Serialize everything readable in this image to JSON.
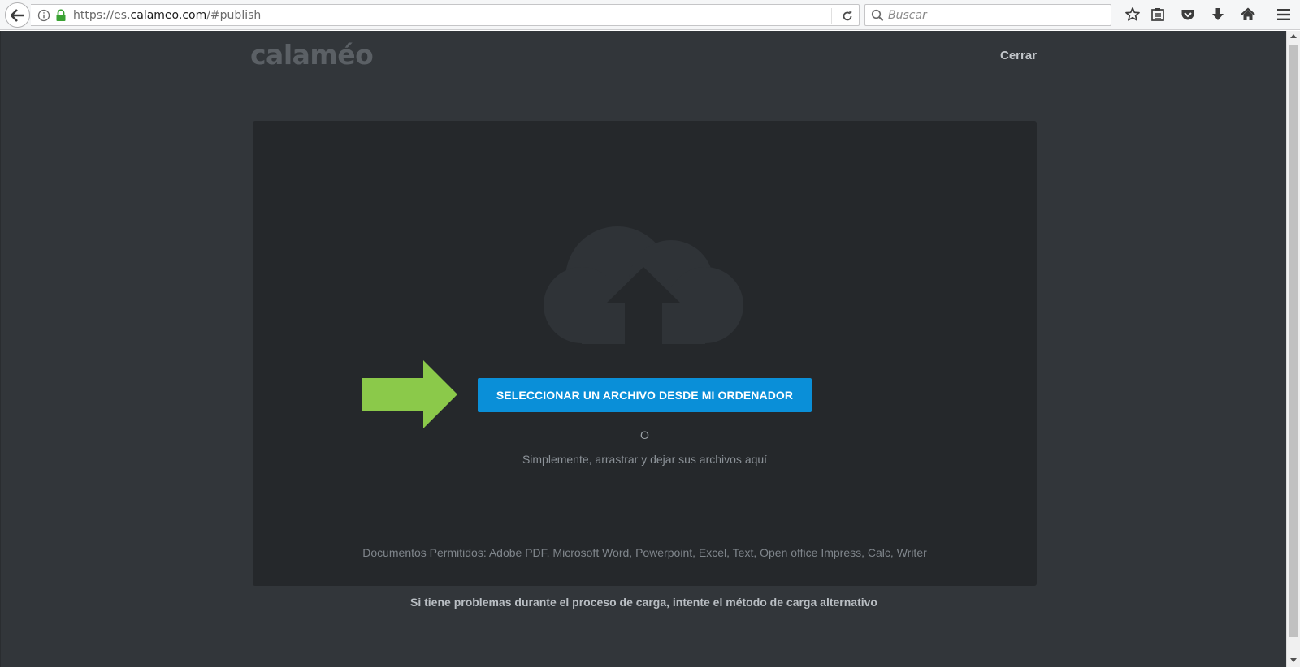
{
  "browser": {
    "url_prefix": "https://es.",
    "url_host": "calameo.com",
    "url_path": "/#publish",
    "search_placeholder": "Buscar",
    "toolbar_icons": [
      "back-icon",
      "info-icon",
      "lock-icon",
      "reload-icon",
      "search-icon",
      "bookmark-star-icon",
      "reading-list-icon",
      "pocket-icon",
      "download-icon",
      "home-icon",
      "menu-icon"
    ]
  },
  "header": {
    "logo": "calaméo",
    "close_label": "Cerrar"
  },
  "upload": {
    "select_button": "SELECCIONAR UN ARCHIVO DESDE MI ORDENADOR",
    "or": "O",
    "drag_hint": "Simplemente, arrastrar y dejar sus archivos aquí",
    "allowed_formats": "Documentos Permitidos: Adobe PDF, Microsoft Word, Powerpoint, Excel, Text, Open office Impress, Calc, Writer"
  },
  "footer": {
    "alternative_link": "Si tiene problemas durante el proceso de carga, intente el método de carga alternativo"
  },
  "colors": {
    "page_bg": "#32363a",
    "dropzone_bg": "#25282b",
    "button_blue": "#0a8fd8",
    "arrow_green": "#8bc94a"
  }
}
